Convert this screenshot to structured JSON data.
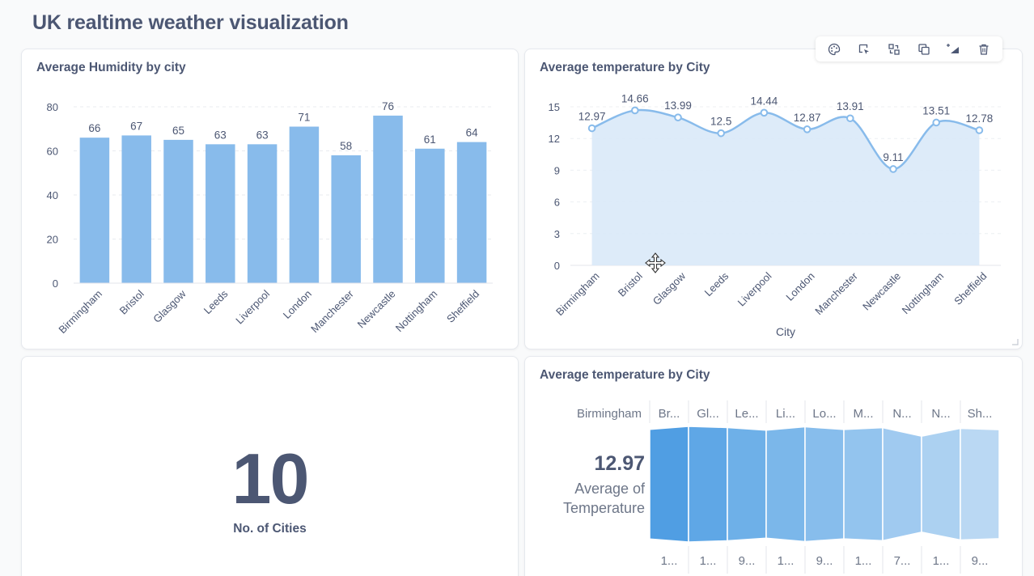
{
  "dashboard": {
    "title": "UK realtime weather visualization"
  },
  "toolbar": {
    "icons": [
      "palette-icon",
      "click-behavior-icon",
      "replace-icon",
      "duplicate-icon",
      "add-series-icon",
      "trash-icon"
    ]
  },
  "humidity_card": {
    "title": "Average Humidity by city"
  },
  "temperature_line_card": {
    "title": "Average temperature by City"
  },
  "count_card": {
    "value": "10",
    "label": "No. of Cities"
  },
  "funnel_card": {
    "title": "Average temperature by City",
    "value": "12.97",
    "metric_line1": "Average of",
    "metric_line2": "Temperature",
    "first_step_label": "Birmingham",
    "step_headers": [
      "Br...",
      "Gl...",
      "Le...",
      "Li...",
      "Lo...",
      "M...",
      "N...",
      "N...",
      "Sh..."
    ],
    "step_footers": [
      "1...",
      "1...",
      "9...",
      "1...",
      "9...",
      "1...",
      "7...",
      "1...",
      "9..."
    ]
  },
  "chart_data": [
    {
      "type": "bar",
      "title": "Average Humidity by city",
      "categories": [
        "Birmingham",
        "Bristol",
        "Glasgow",
        "Leeds",
        "Liverpool",
        "London",
        "Manchester",
        "Newcastle",
        "Nottingham",
        "Sheffield"
      ],
      "values": [
        66,
        67,
        65,
        63,
        63,
        71,
        58,
        76,
        61,
        64
      ],
      "yticks": [
        0,
        20,
        40,
        60,
        80
      ],
      "ylim": [
        0,
        80
      ],
      "grid": true,
      "color": "#88bbeb"
    },
    {
      "type": "area",
      "title": "Average temperature by City",
      "xlabel": "City",
      "categories": [
        "Birmingham",
        "Bristol",
        "Glasgow",
        "Leeds",
        "Liverpool",
        "London",
        "Manchester",
        "Newcastle",
        "Nottingham",
        "Sheffield"
      ],
      "values": [
        12.97,
        14.66,
        13.99,
        12.5,
        14.44,
        12.87,
        13.91,
        9.11,
        13.51,
        12.78
      ],
      "yticks": [
        0,
        3,
        6,
        9,
        12,
        15
      ],
      "ylim": [
        0,
        15
      ],
      "grid": true,
      "color": "#88bbeb"
    },
    {
      "type": "funnel",
      "title": "Average temperature by City",
      "categories": [
        "Birmingham",
        "Bristol",
        "Glasgow",
        "Leeds",
        "Liverpool",
        "London",
        "Manchester",
        "Newcastle",
        "Nottingham",
        "Sheffield"
      ],
      "values": [
        12.97,
        14.66,
        13.99,
        12.5,
        14.44,
        12.87,
        13.91,
        9.11,
        13.51,
        12.78
      ]
    }
  ]
}
